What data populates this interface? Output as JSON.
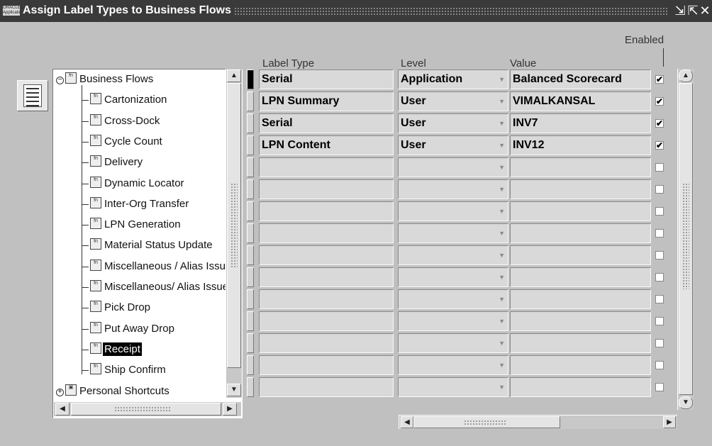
{
  "window": {
    "title": "Assign Label Types to Business Flows",
    "app_icon_text": "ORACLE Applications",
    "controls": [
      "minimize-icon",
      "maximize-icon",
      "close-icon"
    ]
  },
  "tree": {
    "root": {
      "label": "Business Flows",
      "expander": "−"
    },
    "items": [
      {
        "label": "Cartonization"
      },
      {
        "label": "Cross-Dock"
      },
      {
        "label": "Cycle Count"
      },
      {
        "label": "Delivery"
      },
      {
        "label": "Dynamic Locator"
      },
      {
        "label": "Inter-Org Transfer"
      },
      {
        "label": "LPN Generation"
      },
      {
        "label": "Material Status Update"
      },
      {
        "label": "Miscellaneous / Alias Issue"
      },
      {
        "label": "Miscellaneous/ Alias Issue"
      },
      {
        "label": "Pick Drop"
      },
      {
        "label": "Put Away Drop"
      },
      {
        "label": "Receipt",
        "selected": true
      },
      {
        "label": "Ship Confirm"
      }
    ],
    "personal": {
      "label": "Personal Shortcuts",
      "expander": "+"
    }
  },
  "grid": {
    "headers": {
      "label_type": "Label Type",
      "level": "Level",
      "value": "Value",
      "enabled": "Enabled"
    },
    "rows": [
      {
        "label_type": "Serial",
        "level": "Application",
        "value": "Balanced Scorecard",
        "enabled": true,
        "current": true
      },
      {
        "label_type": "LPN Summary",
        "level": "User",
        "value": "VIMALKANSAL",
        "enabled": true
      },
      {
        "label_type": "Serial",
        "level": "User",
        "value": "INV7",
        "enabled": true
      },
      {
        "label_type": "LPN Content",
        "level": "User",
        "value": "INV12",
        "enabled": true
      },
      {
        "label_type": "",
        "level": "",
        "value": "",
        "enabled": false
      },
      {
        "label_type": "",
        "level": "",
        "value": "",
        "enabled": false
      },
      {
        "label_type": "",
        "level": "",
        "value": "",
        "enabled": false
      },
      {
        "label_type": "",
        "level": "",
        "value": "",
        "enabled": false
      },
      {
        "label_type": "",
        "level": "",
        "value": "",
        "enabled": false
      },
      {
        "label_type": "",
        "level": "",
        "value": "",
        "enabled": false
      },
      {
        "label_type": "",
        "level": "",
        "value": "",
        "enabled": false
      },
      {
        "label_type": "",
        "level": "",
        "value": "",
        "enabled": false
      },
      {
        "label_type": "",
        "level": "",
        "value": "",
        "enabled": false
      },
      {
        "label_type": "",
        "level": "",
        "value": "",
        "enabled": false
      },
      {
        "label_type": "",
        "level": "",
        "value": "",
        "enabled": false
      }
    ]
  },
  "colors": {
    "titlebar": "#3a3a3a",
    "background": "#c0c0c0",
    "cell": "#d9d9d9",
    "selected": "#000000"
  }
}
